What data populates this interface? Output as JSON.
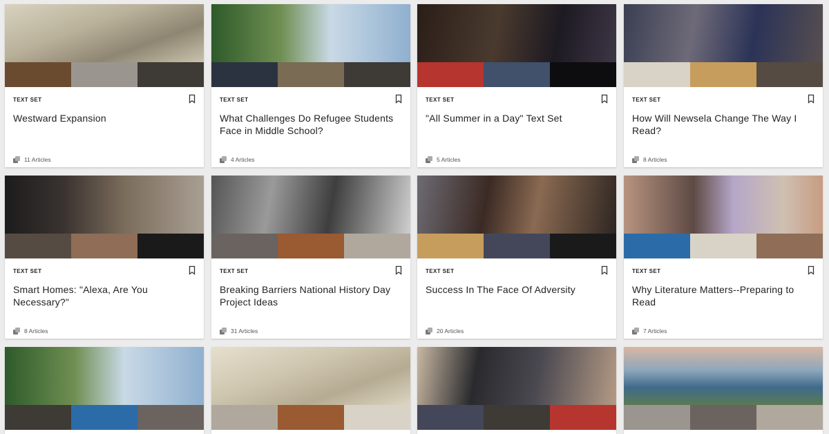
{
  "cards": [
    {
      "type": "TEXT SET",
      "title": "Westward Expansion",
      "count": "11 Articles",
      "bookmark_icon": "bookmark-icon"
    },
    {
      "type": "TEXT SET",
      "title": "What Challenges Do Refugee Students Face in Middle School?",
      "count": "4 Articles",
      "bookmark_icon": "bookmark-icon"
    },
    {
      "type": "TEXT SET",
      "title": "\"All Summer in a Day\" Text Set",
      "count": "5 Articles",
      "bookmark_icon": "bookmark-icon"
    },
    {
      "type": "TEXT SET",
      "title": "How Will Newsela Change The Way I Read?",
      "count": "8 Articles",
      "bookmark_icon": "bookmark-icon"
    },
    {
      "type": "TEXT SET",
      "title": "Smart Homes: \"Alexa, Are You Necessary?\"",
      "count": "8 Articles",
      "bookmark_icon": "bookmark-icon"
    },
    {
      "type": "TEXT SET",
      "title": "Breaking Barriers National History Day Project Ideas",
      "count": "31 Articles",
      "bookmark_icon": "bookmark-icon"
    },
    {
      "type": "TEXT SET",
      "title": "Success In The Face Of Adversity",
      "count": "20 Articles",
      "bookmark_icon": "bookmark-icon"
    },
    {
      "type": "TEXT SET",
      "title": "Why Literature Matters--Preparing to Read",
      "count": "7 Articles",
      "bookmark_icon": "bookmark-icon"
    }
  ],
  "colors": {
    "background": "#ececec",
    "card": "#ffffff",
    "text": "#222222",
    "muted": "#555555"
  }
}
